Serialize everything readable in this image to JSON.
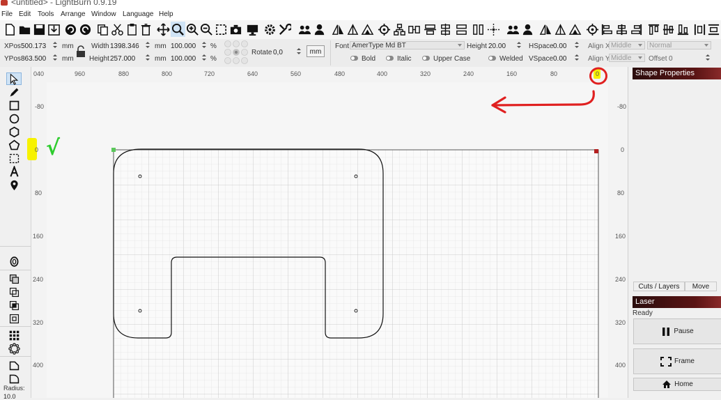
{
  "window": {
    "title": "<untitled> - LightBurn 0.9.19"
  },
  "menu": [
    "File",
    "Edit",
    "Tools",
    "Arrange",
    "Window",
    "Language",
    "Help"
  ],
  "props": {
    "xpos_label": "XPos",
    "xpos": "500.173",
    "ypos_label": "YPos",
    "ypos": "863.500",
    "unit": "mm",
    "width_label": "Width",
    "width": "1398.346",
    "height_label": "Height",
    "height": "257.000",
    "scale_w": "100.000",
    "scale_h": "100.000",
    "percent": "%",
    "rotate_label": "Rotate",
    "rotate": "0,0",
    "units_button": "mm",
    "font_label": "Font",
    "font": "AmerType Md BT",
    "text_height_label": "Height",
    "text_height": "20.00",
    "hspace_label": "HSpace",
    "hspace": "0.00",
    "vspace_label": "VSpace",
    "vspace": "0.00",
    "bold": "Bold",
    "italic": "Italic",
    "upper_case": "Upper Case",
    "welded": "Welded",
    "alignx_label": "Align X",
    "alignx": "Middle",
    "aligny_label": "Align Y",
    "aligny": "Middle",
    "mode": "Normal",
    "offset_label": "Offset",
    "offset": "0"
  },
  "ruler": {
    "top": [
      "040",
      "960",
      "880",
      "800",
      "720",
      "640",
      "560",
      "480",
      "400",
      "320",
      "240",
      "160",
      "80",
      "0"
    ],
    "left": [
      "-80",
      "0",
      "80",
      "160",
      "240",
      "320",
      "400"
    ],
    "right": [
      "-80",
      "0",
      "80",
      "160",
      "240",
      "320",
      "400"
    ]
  },
  "left_tools_bottom": {
    "radius_label": "Radius:",
    "radius_value": "10.0"
  },
  "panels": {
    "shape_properties": "Shape Properties",
    "tab_cuts": "Cuts / Layers",
    "tab_move": "Move",
    "laser": "Laser",
    "status": "Ready",
    "pause": "Pause",
    "frame": "Frame",
    "home": "Home"
  },
  "annotation": {
    "mark": "√"
  },
  "colors": {
    "panel_header": "#3a0f0f",
    "annotation_red": "#e02020",
    "highlight": "#f7f200",
    "check_green": "#2ecc2e"
  }
}
